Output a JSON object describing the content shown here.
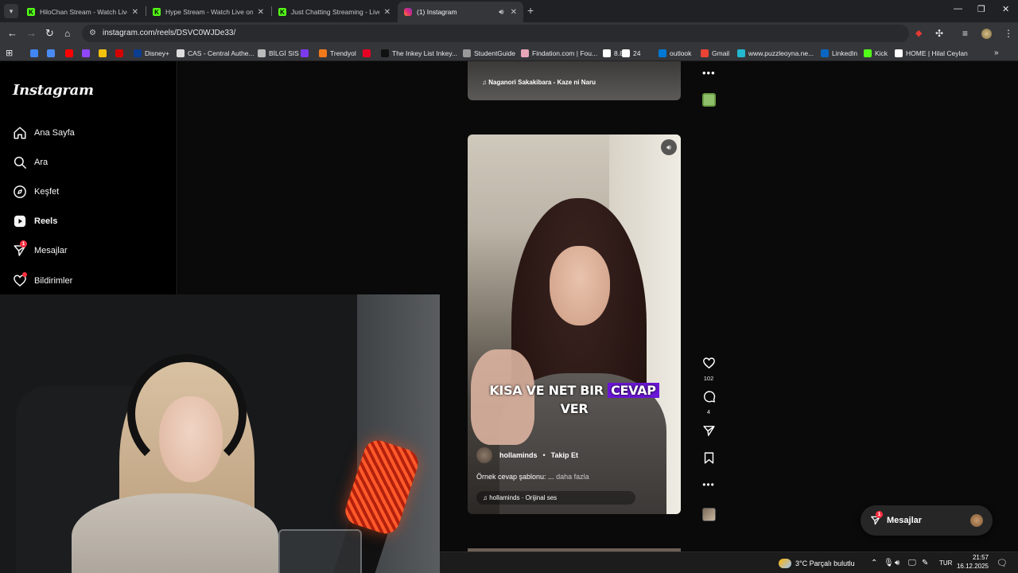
{
  "browser": {
    "tabs": [
      {
        "title": "HiloChan Stream - Watch Live o",
        "favicon_color": "#53fc18",
        "active": false
      },
      {
        "title": "Hype Stream - Watch Live on K",
        "favicon_color": "#53fc18",
        "active": false
      },
      {
        "title": "Just Chatting Streaming - Live",
        "favicon_color": "#53fc18",
        "active": false
      },
      {
        "title": "(1) Instagram",
        "favicon_color": "#d62976",
        "active": true
      }
    ],
    "url": "instagram.com/reels/DSVC0WJDe33/",
    "bookmarks": [
      {
        "label": "",
        "color": "#4285f4"
      },
      {
        "label": "",
        "color": "#4a8af4"
      },
      {
        "label": "",
        "color": "#ff0000"
      },
      {
        "label": "",
        "color": "#9146ff"
      },
      {
        "label": "",
        "color": "#f4c20d"
      },
      {
        "label": "",
        "color": "#d50000"
      },
      {
        "label": "Disney+",
        "color": "#0b3d91"
      },
      {
        "label": "CAS - Central Authe...",
        "color": "#dddddd"
      },
      {
        "label": "BİLGİ SIS",
        "color": "#bbbbbb"
      },
      {
        "label": "",
        "color": "#7c3aed"
      },
      {
        "label": "Trendyol",
        "color": "#f27a1a"
      },
      {
        "label": "",
        "color": "#e60023"
      },
      {
        "label": "The Inkey List Inkey...",
        "color": "#111111"
      },
      {
        "label": "StudentGuide",
        "color": "#999999"
      },
      {
        "label": "Findation.com | Fou...",
        "color": "#e7a6b8"
      },
      {
        "label": "8.8",
        "color": "#ffffff"
      },
      {
        "label": "24",
        "color": "#ffffff"
      },
      {
        "label": "outlook",
        "color": "#0078d4"
      },
      {
        "label": "Gmail",
        "color": "#ea4335"
      },
      {
        "label": "www.puzzleoyna.ne...",
        "color": "#22b8cf"
      },
      {
        "label": "LinkedIn",
        "color": "#0a66c2"
      },
      {
        "label": "Kick",
        "color": "#53fc18"
      },
      {
        "label": "HOME | Hilal Ceylan",
        "color": "#ffffff"
      }
    ]
  },
  "instagram": {
    "logo": "Instagram",
    "nav": [
      {
        "label": "Ana Sayfa",
        "icon": "home-icon",
        "badge": ""
      },
      {
        "label": "Ara",
        "icon": "search-icon",
        "badge": ""
      },
      {
        "label": "Keşfet",
        "icon": "compass-icon",
        "badge": ""
      },
      {
        "label": "Reels",
        "icon": "reels-icon",
        "badge": ""
      },
      {
        "label": "Mesajlar",
        "icon": "messenger-icon",
        "badge": "1"
      },
      {
        "label": "Bildirimler",
        "icon": "heart-icon",
        "badge": ""
      }
    ],
    "prev_reel": {
      "audio": "Naganori Sakakibara - Kaze ni Naru"
    },
    "reel": {
      "caption_before": "KISA VE NET BIR ",
      "caption_highlight": "CEVAP",
      "caption_after": "VER",
      "author": "hollaminds",
      "dot": "•",
      "follow": "Takip Et",
      "description": "Örnek cevap şablonu: ...",
      "more": "daha fazla",
      "audio": "hollaminds · Orijinal ses",
      "likes": "102",
      "comments": "4",
      "accent": "#6b16d6"
    },
    "messages_pill": {
      "label": "Mesajlar",
      "badge": "1"
    }
  },
  "taskbar": {
    "weather": "3°C  Parçalı bulutlu",
    "lang": "TUR",
    "time": "21:57",
    "date": "16.12.2025"
  }
}
